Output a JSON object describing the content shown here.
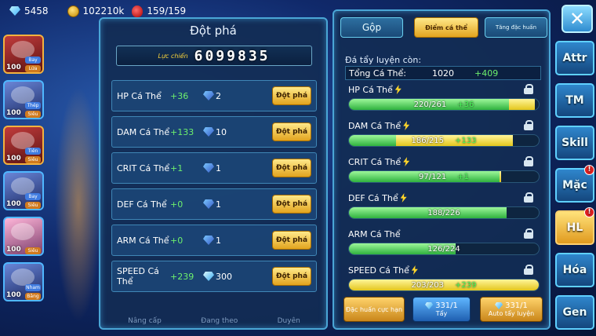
{
  "resources": {
    "diamonds": "5458",
    "gold": "102210k",
    "stamina": "159/159"
  },
  "characters": [
    {
      "level": "100",
      "tag1": "Bay",
      "tag2": "Lửa"
    },
    {
      "level": "100",
      "tag1": "Thép",
      "tag2": "Siêu"
    },
    {
      "level": "100",
      "tag1": "Tiên",
      "tag2": "Siêu"
    },
    {
      "level": "100",
      "tag1": "Bay",
      "tag2": "Siêu"
    },
    {
      "level": "100",
      "tag1": "",
      "tag2": "Siêu"
    },
    {
      "level": "100",
      "tag1": "Nham",
      "tag2": "Băng"
    }
  ],
  "breakthrough": {
    "title": "Đột phá",
    "power_label": "Lực chiến",
    "power_value": "6099835",
    "rows": [
      {
        "name": "HP Cá Thể",
        "inc": "+36",
        "count": "2",
        "currency": "crystal",
        "button": "Đột phá"
      },
      {
        "name": "DAM Cá Thể",
        "inc": "+133",
        "count": "10",
        "currency": "crystal",
        "button": "Đột phá"
      },
      {
        "name": "CRIT Cá Thể",
        "inc": "+1",
        "count": "1",
        "currency": "crystal",
        "button": "Đột phá"
      },
      {
        "name": "DEF Cá Thể",
        "inc": "+0",
        "count": "1",
        "currency": "crystal",
        "button": "Đột phá"
      },
      {
        "name": "ARM Cá Thể",
        "inc": "+0",
        "count": "1",
        "currency": "crystal",
        "button": "Đột phá"
      },
      {
        "name": "SPEED Cá Thể",
        "inc": "+239",
        "count": "300",
        "currency": "diamond",
        "button": "Đột phá"
      }
    ],
    "under_tabs": [
      "Nâng cấp",
      "Đang theo",
      "Duyên"
    ]
  },
  "training": {
    "tabs": [
      "Gộp",
      "Điểm cá thể",
      "Tăng đặc huấn"
    ],
    "remaining_label": "Đá tẩy luyện còn:",
    "total_label": "Tổng Cá Thể:",
    "total_value": "1020",
    "total_bonus": "+409",
    "stats": [
      {
        "name": "HP Cá Thể",
        "bolt": true,
        "value": "220/261",
        "bonus": "+36",
        "base": 220,
        "extra": 36,
        "max": 261
      },
      {
        "name": "DAM Cá Thể",
        "bolt": true,
        "value": "186/215",
        "bonus": "+133",
        "base": 53,
        "extra": 133,
        "max": 215
      },
      {
        "name": "CRIT Cá Thể",
        "bolt": true,
        "value": "97/121",
        "bonus": "+1",
        "base": 96,
        "extra": 1,
        "max": 121
      },
      {
        "name": "DEF Cá Thể",
        "bolt": true,
        "value": "188/226",
        "bonus": "",
        "base": 188,
        "extra": 0,
        "max": 226
      },
      {
        "name": "ARM Cá Thể",
        "bolt": false,
        "value": "126/224",
        "bonus": "",
        "base": 126,
        "extra": 0,
        "max": 224
      },
      {
        "name": "SPEED Cá Thể",
        "bolt": true,
        "value": "203/203",
        "bonus": "+239",
        "base": 0,
        "extra": 203,
        "max": 203
      }
    ],
    "buttons": {
      "special": "Đặc huấn cực hạn",
      "wash_count": "331/1",
      "wash_label": "Tẩy",
      "auto_count": "331/1",
      "auto_label": "Auto tẩy luyện"
    }
  },
  "side_nav": [
    "Attr",
    "TM",
    "Skill",
    "Mặc",
    "HL",
    "Hóa",
    "Gen"
  ],
  "side_nav_badges": {
    "Mặc": "!",
    "HL": "!"
  }
}
